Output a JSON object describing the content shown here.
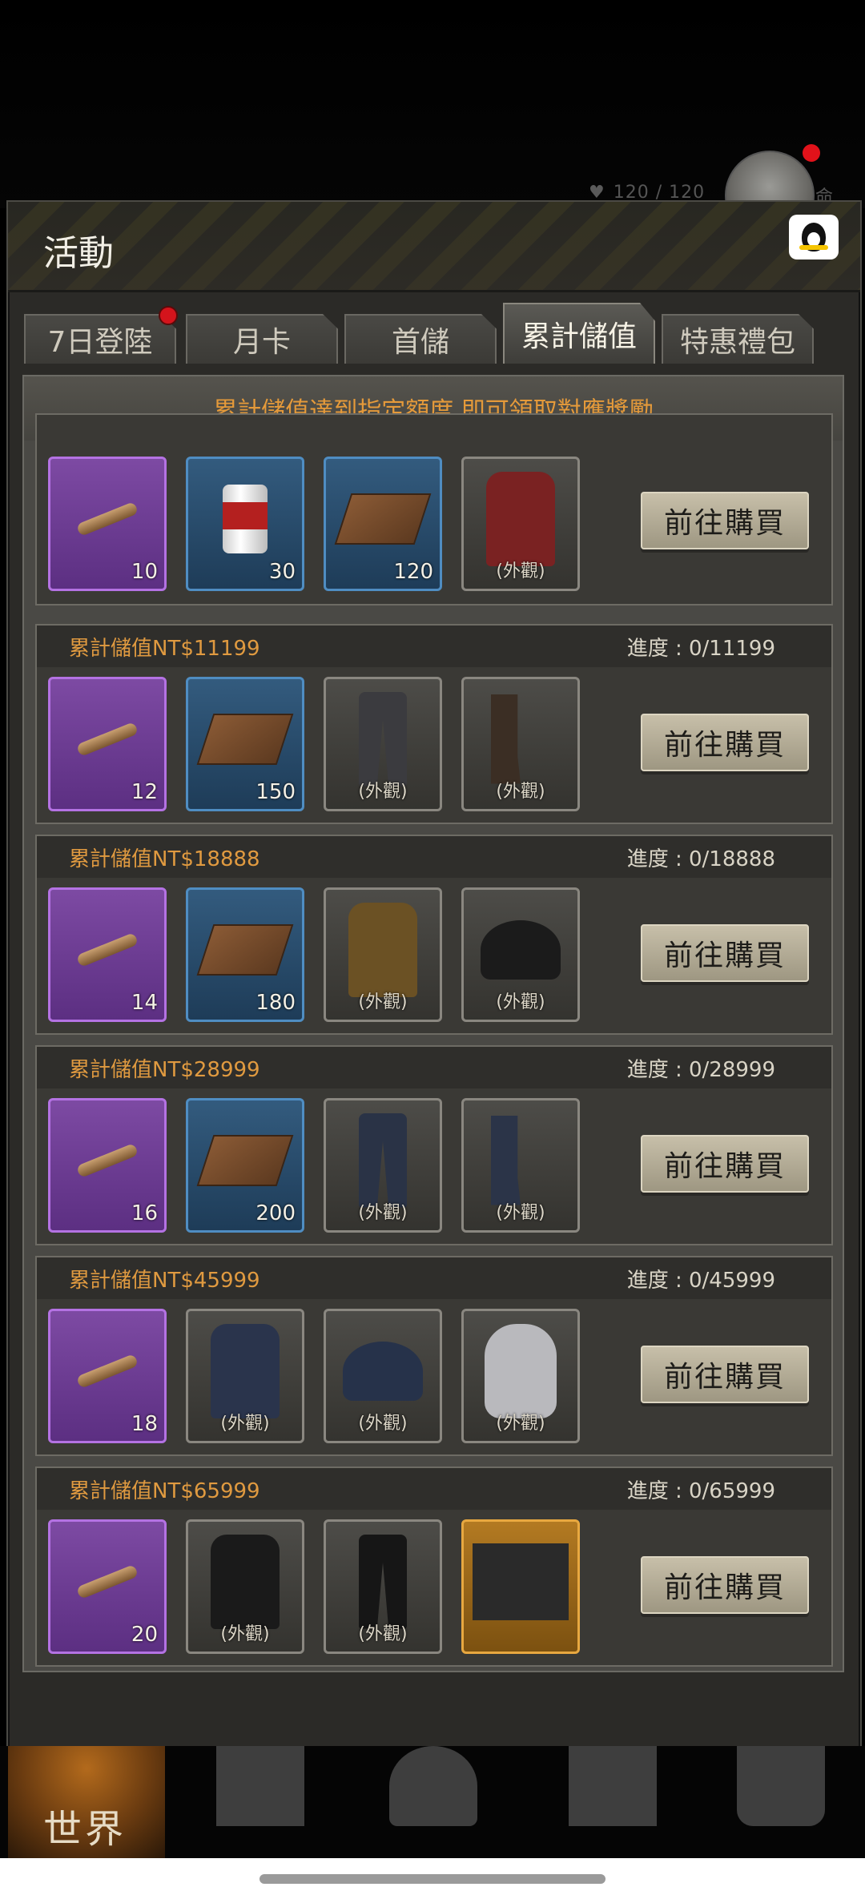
{
  "status": {
    "hp": "120 / 120",
    "side_char": "命"
  },
  "header": {
    "title": "活動"
  },
  "tabs": [
    {
      "label": "7日登陸",
      "active": false,
      "has_dot": true
    },
    {
      "label": "月卡",
      "active": false
    },
    {
      "label": "首儲",
      "active": false
    },
    {
      "label": "累計儲值",
      "active": true
    },
    {
      "label": "特惠禮包",
      "active": false
    }
  ],
  "notice": "累計儲值達到指定額度,即可領取對應獎勵",
  "buy_label": "前往購買",
  "skin_label": "(外觀)",
  "rows": [
    {
      "title": "",
      "progress": "",
      "items": [
        {
          "kind": "cigar",
          "rarity": "purple",
          "qty": "10"
        },
        {
          "kind": "can",
          "rarity": "blue",
          "qty": "30"
        },
        {
          "kind": "crate",
          "rarity": "blue",
          "qty": "120"
        },
        {
          "kind": "coat",
          "rarity": "grey",
          "skin": true,
          "color": "#7a2222"
        }
      ]
    },
    {
      "title": "累計儲值NT$11199",
      "progress": "進度 : 0/11199",
      "items": [
        {
          "kind": "cigar",
          "rarity": "purple",
          "qty": "12"
        },
        {
          "kind": "crate",
          "rarity": "blue",
          "qty": "150"
        },
        {
          "kind": "pants",
          "rarity": "grey",
          "skin": true,
          "color": "#3b3b3f"
        },
        {
          "kind": "boots",
          "rarity": "grey",
          "skin": true,
          "color": "#3b2e24"
        }
      ]
    },
    {
      "title": "累計儲值NT$18888",
      "progress": "進度 : 0/18888",
      "items": [
        {
          "kind": "cigar",
          "rarity": "purple",
          "qty": "14"
        },
        {
          "kind": "crate",
          "rarity": "blue",
          "qty": "180"
        },
        {
          "kind": "coat",
          "rarity": "grey",
          "skin": true,
          "color": "#6b5124"
        },
        {
          "kind": "hat",
          "rarity": "grey",
          "skin": true,
          "color": "#1b1b1b"
        }
      ]
    },
    {
      "title": "累計儲值NT$28999",
      "progress": "進度 : 0/28999",
      "items": [
        {
          "kind": "cigar",
          "rarity": "purple",
          "qty": "16"
        },
        {
          "kind": "crate",
          "rarity": "blue",
          "qty": "200"
        },
        {
          "kind": "pants",
          "rarity": "grey",
          "skin": true,
          "color": "#2a3346"
        },
        {
          "kind": "boots",
          "rarity": "grey",
          "skin": true,
          "color": "#2b3448"
        }
      ]
    },
    {
      "title": "累計儲值NT$45999",
      "progress": "進度 : 0/45999",
      "items": [
        {
          "kind": "cigar",
          "rarity": "purple",
          "qty": "18"
        },
        {
          "kind": "coat",
          "rarity": "grey",
          "skin": true,
          "color": "#2a344c"
        },
        {
          "kind": "hat",
          "rarity": "grey",
          "skin": true,
          "color": "#26324a"
        },
        {
          "kind": "torso",
          "rarity": "grey",
          "skin": true,
          "color": "#b9b9bd"
        }
      ]
    },
    {
      "title": "累計儲值NT$65999",
      "progress": "進度 : 0/65999",
      "items": [
        {
          "kind": "cigar",
          "rarity": "purple",
          "qty": "20"
        },
        {
          "kind": "coat",
          "rarity": "grey",
          "skin": true,
          "color": "#1a1a1a"
        },
        {
          "kind": "pants",
          "rarity": "grey",
          "skin": true,
          "color": "#161616"
        },
        {
          "kind": "bike",
          "rarity": "gold",
          "skin": false,
          "color": "#2a2a2a"
        }
      ]
    }
  ],
  "nav": {
    "world_label": "世界"
  },
  "colors": {
    "accent_orange": "#e09a40",
    "purple_rarity": "#b472e3",
    "blue_rarity": "#4f8dc2",
    "gold_rarity": "#e8a840",
    "badge_red": "#d4141c"
  }
}
